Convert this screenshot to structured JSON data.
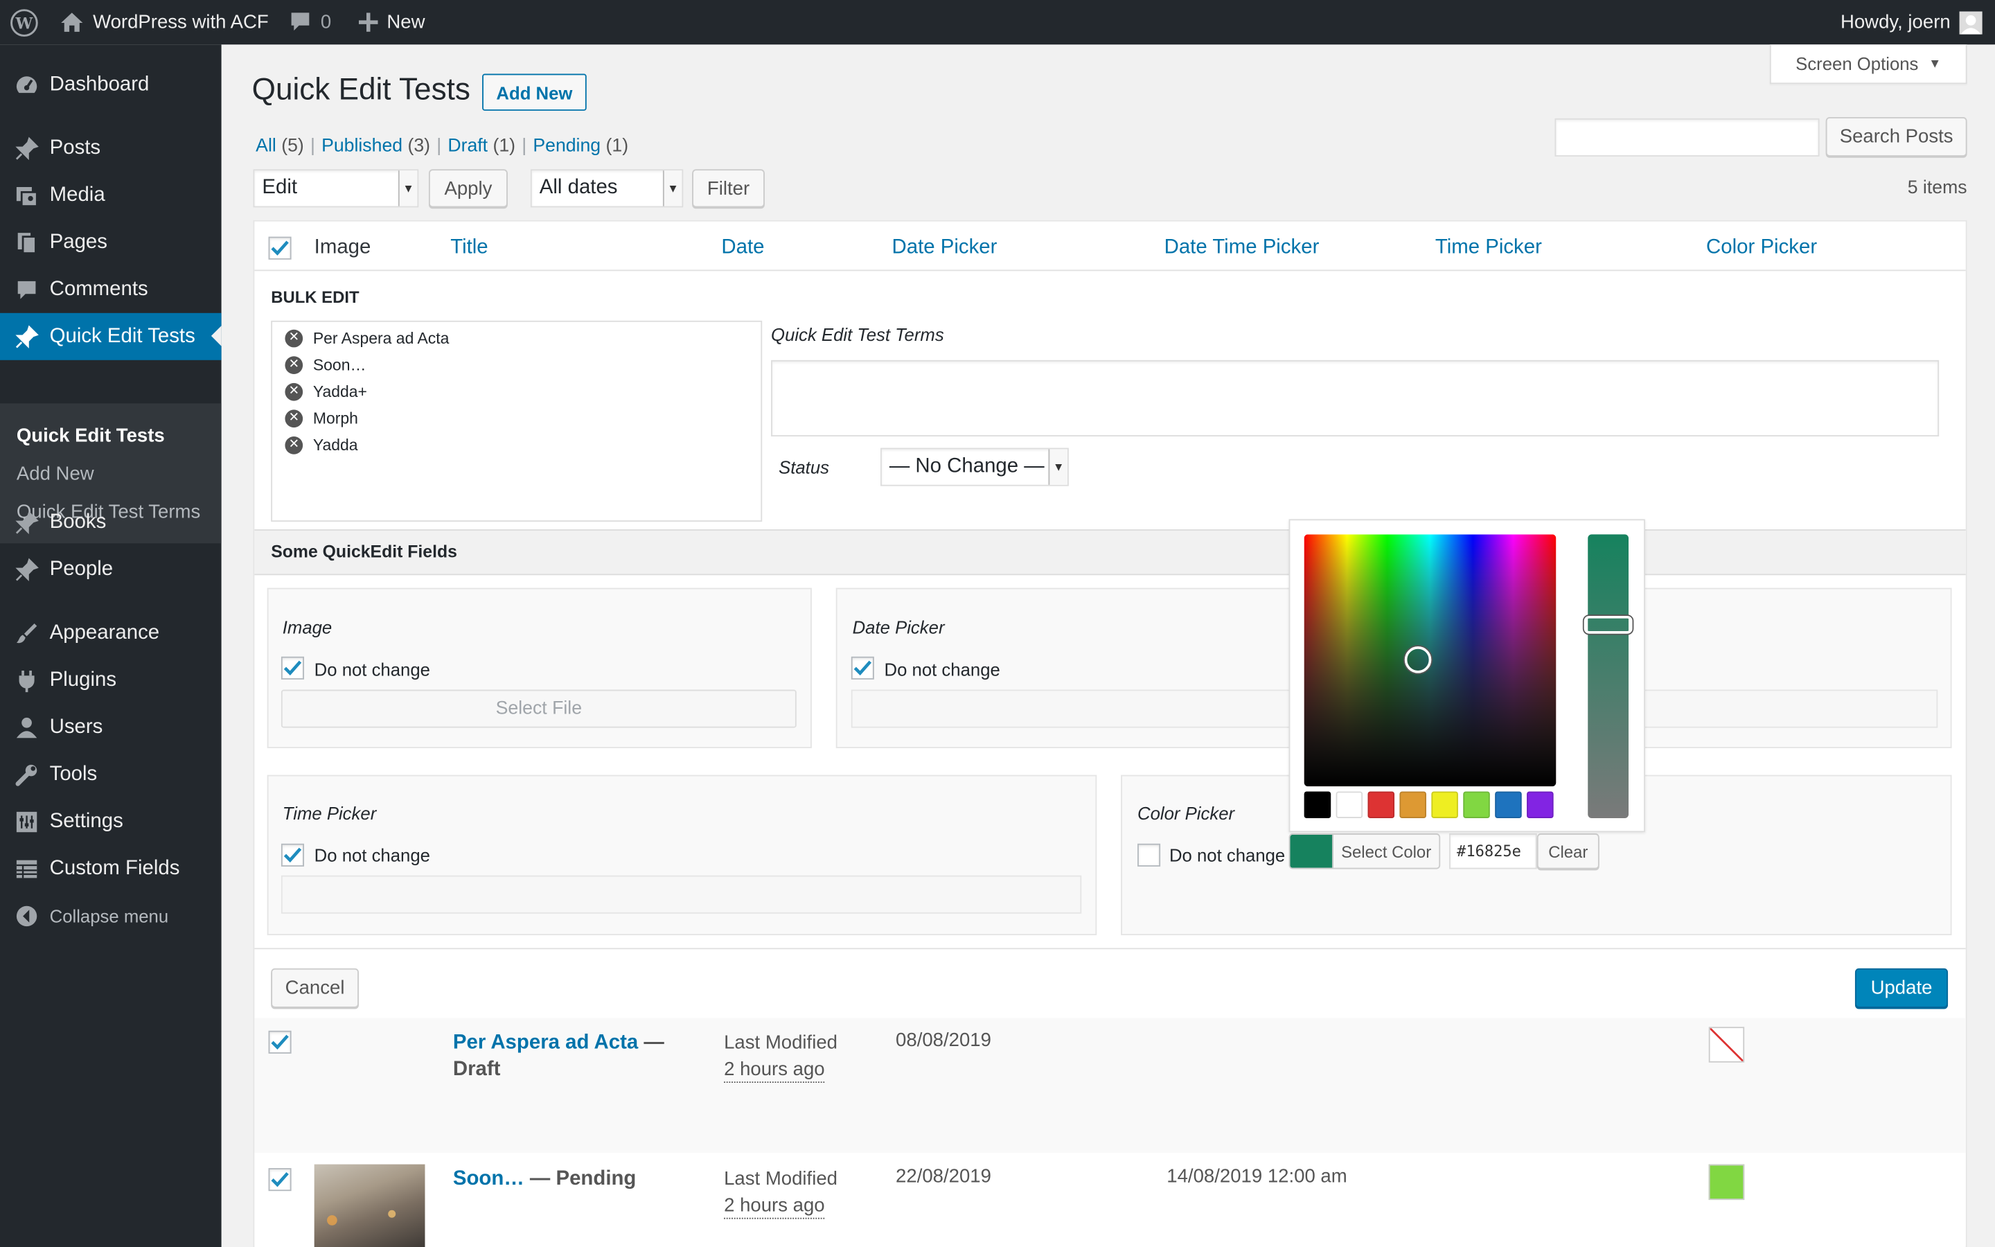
{
  "admin_bar": {
    "site_name": "WordPress with ACF",
    "comments_count": "0",
    "new_label": "New",
    "greeting": "Howdy, joern"
  },
  "sidebar": {
    "items": [
      {
        "label": "Dashboard",
        "icon": "dashboard-icon"
      },
      {
        "label": "Posts",
        "icon": "pin-icon"
      },
      {
        "label": "Media",
        "icon": "media-icon"
      },
      {
        "label": "Pages",
        "icon": "pages-icon"
      },
      {
        "label": "Comments",
        "icon": "comment-icon"
      },
      {
        "label": "Quick Edit Tests",
        "icon": "pin-icon"
      },
      {
        "label": "Books",
        "icon": "pin-icon"
      },
      {
        "label": "People",
        "icon": "pin-icon"
      },
      {
        "label": "Appearance",
        "icon": "brush-icon"
      },
      {
        "label": "Plugins",
        "icon": "plug-icon"
      },
      {
        "label": "Users",
        "icon": "user-icon"
      },
      {
        "label": "Tools",
        "icon": "wrench-icon"
      },
      {
        "label": "Settings",
        "icon": "settings-icon"
      },
      {
        "label": "Custom Fields",
        "icon": "fields-icon"
      }
    ],
    "submenu": [
      "Quick Edit Tests",
      "Add New",
      "Quick Edit Test Terms"
    ],
    "collapse_label": "Collapse menu"
  },
  "header": {
    "title": "Quick Edit Tests",
    "add_new": "Add New",
    "screen_options": "Screen Options"
  },
  "filters": {
    "views": [
      {
        "label": "All",
        "count": "(5)"
      },
      {
        "label": "Published",
        "count": "(3)"
      },
      {
        "label": "Draft",
        "count": "(1)"
      },
      {
        "label": "Pending",
        "count": "(1)"
      }
    ],
    "bulk_action": "Edit",
    "apply": "Apply",
    "dates": "All dates",
    "filter": "Filter",
    "search_button": "Search Posts",
    "search_value": "",
    "items_count": "5 items"
  },
  "table": {
    "columns": [
      "Image",
      "Title",
      "Date",
      "Date Picker",
      "Date Time Picker",
      "Time Picker",
      "Color Picker"
    ]
  },
  "bulk_edit": {
    "heading": "BULK EDIT",
    "posts": [
      "Per Aspera ad Acta",
      "Soon…",
      "Yadda+",
      "Morph",
      "Yadda"
    ],
    "terms_label": "Quick Edit Test Terms",
    "terms_value": "",
    "status_label": "Status",
    "status_value": "— No Change —",
    "section_title": "Some QuickEdit Fields",
    "image_label": "Image",
    "do_not_change": "Do not change",
    "select_file": "Select File",
    "date_picker_label": "Date Picker",
    "time_picker_label": "Time Picker",
    "color_picker_label": "Color Picker",
    "select_color": "Select Color",
    "color_hex": "#16825e",
    "clear": "Clear",
    "cancel": "Cancel",
    "update": "Update"
  },
  "color_picker": {
    "current": "#16825e",
    "palette": [
      "#000000",
      "#ffffff",
      "#dd3333",
      "#dd9933",
      "#eeee22",
      "#81d742",
      "#1e73be",
      "#8224e3"
    ]
  },
  "rows": [
    {
      "title": "Per Aspera ad Acta",
      "state": "— Draft",
      "date_status": "Last Modified",
      "date_ago": "2 hours ago",
      "date_picker": "08/08/2019",
      "date_time_picker": "",
      "color": "none"
    },
    {
      "title": "Soon…",
      "state": "— Pending",
      "date_status": "Last Modified",
      "date_ago": "2 hours ago",
      "date_picker": "22/08/2019",
      "date_time_picker": "14/08/2019 12:00 am",
      "color": "#81d742"
    }
  ]
}
